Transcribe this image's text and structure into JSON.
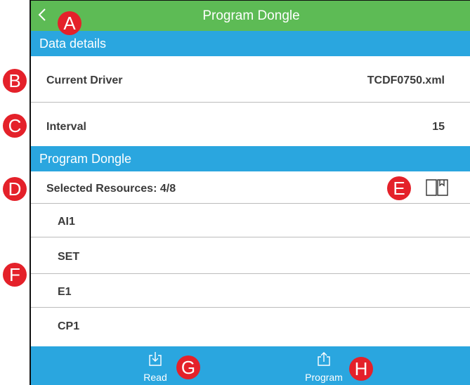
{
  "header": {
    "back_glyph": "<",
    "title": "Program Dongle"
  },
  "data_details": {
    "header": "Data details",
    "current_driver": {
      "label": "Current Driver",
      "value": "TCDF0750.xml"
    },
    "interval": {
      "label": "Interval",
      "value": "15"
    }
  },
  "program_dongle": {
    "header": "Program Dongle",
    "selected_resources": "Selected Resources: 4/8",
    "resources": [
      "AI1",
      "SET",
      "E1",
      "CP1"
    ]
  },
  "toolbar": {
    "read_label": "Read",
    "program_label": "Program"
  },
  "markers": [
    "A",
    "B",
    "C",
    "D",
    "E",
    "F",
    "G",
    "H"
  ],
  "colors": {
    "title_bar": "#5dbb55",
    "section": "#2aa6df",
    "marker": "#e4212a"
  }
}
